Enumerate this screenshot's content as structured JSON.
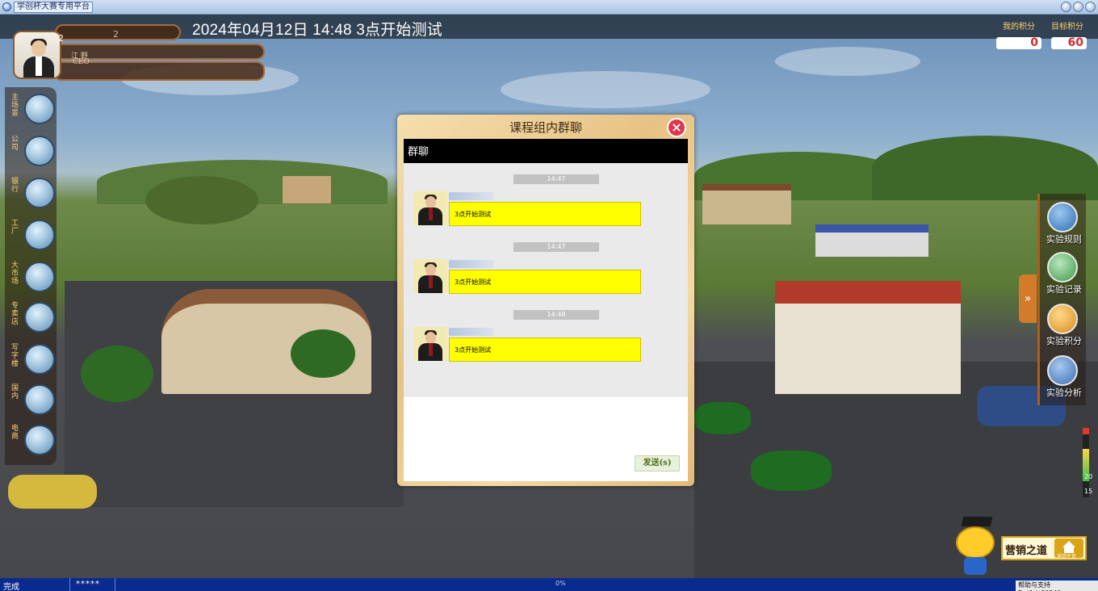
{
  "window": {
    "title": "学创杯大赛专用平台"
  },
  "banner": {
    "datetime_text": "2024年04月12日 14:48  3点开始测试"
  },
  "score": {
    "my_score_label": "我的积分",
    "target_score_label": "目标积分",
    "my_score": "0",
    "target_score": "60"
  },
  "user": {
    "top_number": "2",
    "number": "2",
    "name": "江 野",
    "role": "CEO"
  },
  "left_menu": [
    {
      "label": "主场景",
      "icon": "home-scene-icon"
    },
    {
      "label": "公司",
      "icon": "company-building-icon"
    },
    {
      "label": "银行",
      "icon": "bank-icon"
    },
    {
      "label": "工厂",
      "icon": "factory-icon"
    },
    {
      "label": "大市场",
      "icon": "market-icon"
    },
    {
      "label": "专卖店",
      "icon": "store-icon"
    },
    {
      "label": "写字楼",
      "icon": "office-tower-icon"
    },
    {
      "label": "国内",
      "icon": "domestic-icon"
    },
    {
      "label": "电商",
      "icon": "ecommerce-icon"
    }
  ],
  "right_menu": [
    {
      "label": "实验规则",
      "icon": "rules-icon",
      "color": "#2a6fb0"
    },
    {
      "label": "实验记录",
      "icon": "record-icon",
      "color": "#3c9a4a"
    },
    {
      "label": "实验积分",
      "icon": "score-medal-icon",
      "color": "#d88a1b"
    },
    {
      "label": "实验分析",
      "icon": "analysis-icon",
      "color": "#3a6fb5"
    }
  ],
  "right_toggle": "»",
  "chat": {
    "title": "课程组内群聊",
    "close_label": "×",
    "header": "群聊",
    "messages": [
      {
        "time": "14:47",
        "text": "3点开始测试"
      },
      {
        "time": "14:47",
        "text": "3点开始测试"
      },
      {
        "time": "14:48",
        "text": "3点开始测试"
      }
    ],
    "send_label": "发送(s)"
  },
  "scroller": {
    "num1": "20",
    "num2": "15"
  },
  "brand": {
    "text": "营销之道",
    "home_label": "返回主页"
  },
  "status": {
    "left": "完成",
    "stars": "*****",
    "progress": "0%",
    "right": "帮助与支持  Build:20240"
  }
}
